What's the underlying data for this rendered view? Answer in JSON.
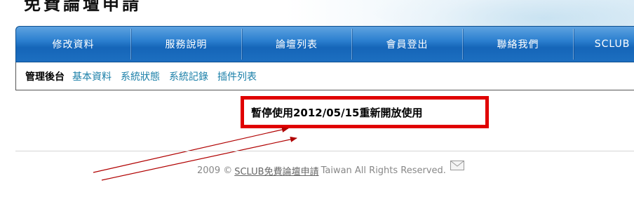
{
  "header": {
    "title": "免費論壇申請"
  },
  "nav": {
    "items": [
      {
        "label": "修改資料"
      },
      {
        "label": "服務說明"
      },
      {
        "label": "論壇列表"
      },
      {
        "label": "會員登出"
      },
      {
        "label": "聯絡我們"
      },
      {
        "label": "SCLUB"
      }
    ]
  },
  "subnav": {
    "current": "管理後台",
    "links": [
      "基本資料",
      "系統狀態",
      "系統記錄",
      "插件列表"
    ]
  },
  "notice": {
    "text": "暫停使用2012/05/15重新開放使用"
  },
  "footer": {
    "prefix": "2009 ©",
    "site_link": "SCLUB免費論壇申請",
    "suffix": "Taiwan All Rights Reserved."
  },
  "colors": {
    "nav_blue": "#2b7fcf",
    "link_teal": "#1a7fa8",
    "notice_red": "#e00000",
    "arrow_red": "#b00000"
  },
  "icons": [
    "envelope-icon"
  ]
}
